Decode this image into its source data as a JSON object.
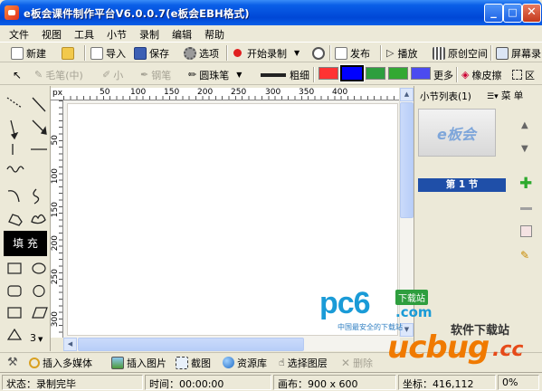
{
  "window": {
    "title": "e板会课件制作平台V6.0.0.7(e板会EBH格式)",
    "controls": {
      "minimize": "_",
      "maximize": "□",
      "close": "✕"
    }
  },
  "menu": [
    "文件",
    "视图",
    "工具",
    "小节",
    "录制",
    "编辑",
    "帮助"
  ],
  "toolbar_main": {
    "new": "新建",
    "import": "导入",
    "save": "保存",
    "options": "选项",
    "start_record": "开始录制",
    "publish": "发布",
    "play": "播放",
    "origin_space": "原创空间",
    "screen_record": "屏幕录"
  },
  "toolbar_draw": {
    "brush": "毛笔(中)",
    "small": "小",
    "pen": "钢笔",
    "ballpen": "圆珠笔",
    "thickness": "粗细",
    "more": "更多",
    "eraser": "橡皮擦",
    "region": "区",
    "colors": [
      "#FF3333",
      "#0000FF",
      "#2E9E3E",
      "#33A833",
      "#4B4BF0"
    ],
    "selected_color_index": 1
  },
  "left_tools": {
    "fill_label": "填 充",
    "count_label": "3"
  },
  "rulers": {
    "px_label": "px",
    "top_ticks": [
      "50",
      "100",
      "150",
      "200",
      "250",
      "300",
      "350",
      "400"
    ],
    "left_ticks": [
      "50",
      "100",
      "150",
      "200",
      "250",
      "300"
    ]
  },
  "right_panel": {
    "title": "小节列表(1)",
    "menu_label": "菜 单",
    "thumb_logo": "e板会",
    "section_label": "第 1 节"
  },
  "toolbar_bottom": {
    "insert_media": "插入多媒体",
    "insert_image": "插入图片",
    "screenshot": "截图",
    "library": "资源库",
    "select_layer": "选择图层",
    "delete": "删除"
  },
  "status": {
    "state": "状态：录制完毕",
    "time": "时间：00:00:00",
    "canvas": "画布：900 x 600",
    "coords": "坐标：416,112",
    "zoom": "0%"
  },
  "watermarks": {
    "pc6_main": "pc6",
    "pc6_sub": ".com",
    "pc6_badge": "下载站",
    "pc6_caption": "中国最安全的下载站",
    "ucbug_badge": "软件下载站",
    "ucbug_main": "ucbug",
    "ucbug_tld": ".cc"
  }
}
